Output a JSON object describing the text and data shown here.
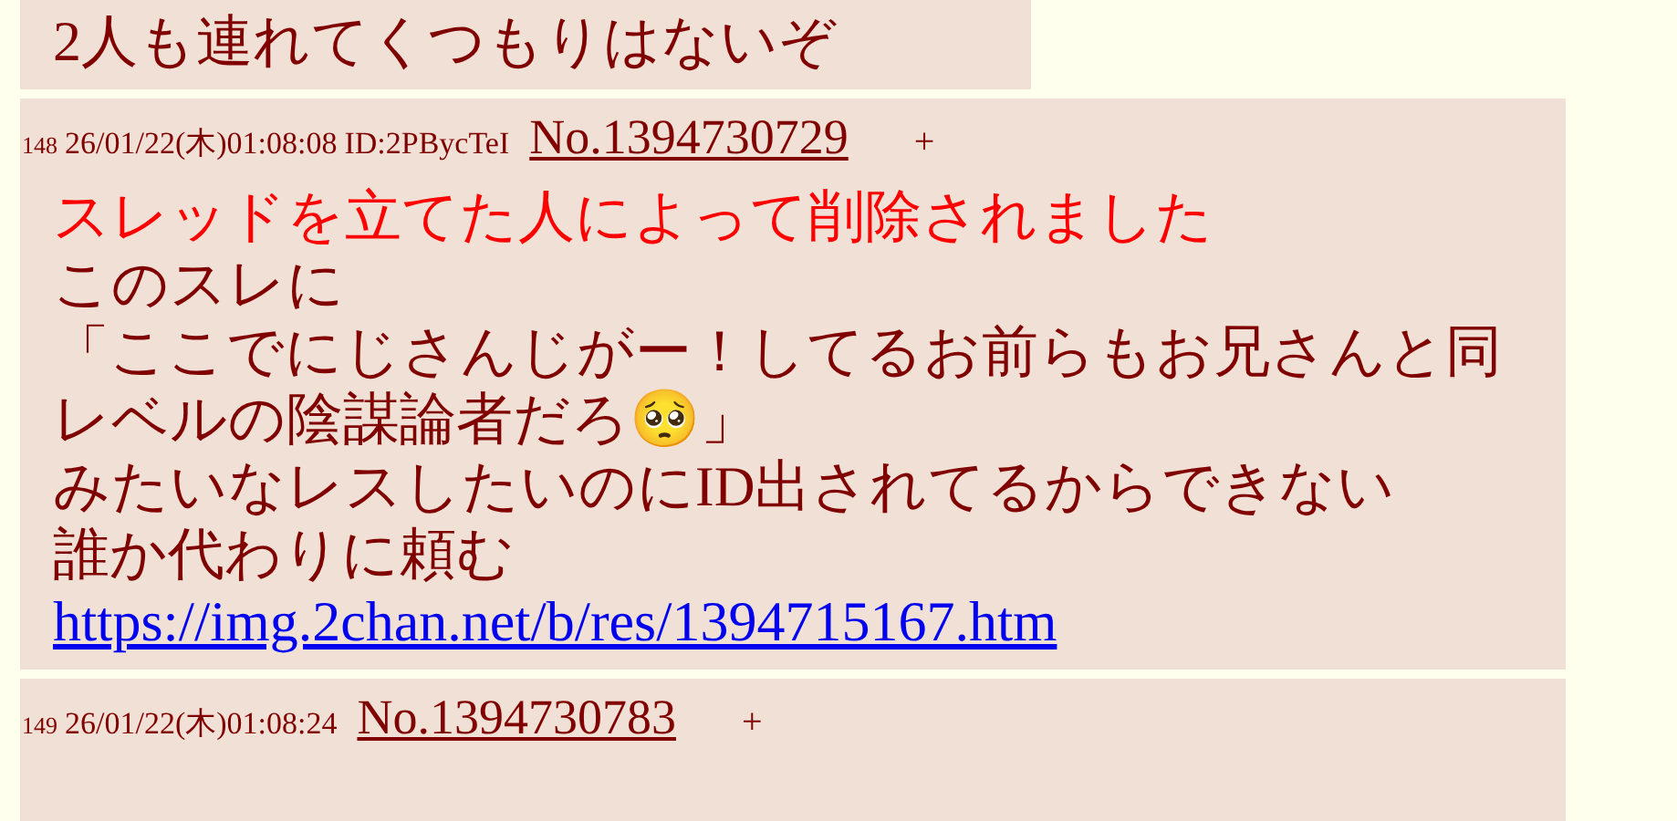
{
  "posts": [
    {
      "lines": [
        {
          "kind": "text",
          "text": "2人も連れてくつもりはないぞ"
        }
      ]
    },
    {
      "number": "148",
      "date": "26/01/22(木)01:08:08",
      "id": "ID:2PBycTeI",
      "no": "No.1394730729",
      "plus": "+",
      "lines": [
        {
          "kind": "deleted",
          "text": "スレッドを立てた人によって削除されました"
        },
        {
          "kind": "text",
          "text": "このスレに"
        },
        {
          "kind": "text",
          "text": "「ここでにじさんじがー！してるお前らもお兄さんと同"
        },
        {
          "kind": "text",
          "text": "レベルの陰謀論者だろ🥺」"
        },
        {
          "kind": "text",
          "text": "みたいなレスしたいのにID出されてるからできない"
        },
        {
          "kind": "text",
          "text": "誰か代わりに頼む"
        },
        {
          "kind": "link",
          "text": "https://img.2chan.net/b/res/1394715167.htm"
        }
      ]
    },
    {
      "number": "149",
      "date": "26/01/22(木)01:08:24",
      "no": "No.1394730783",
      "plus": "+"
    }
  ]
}
